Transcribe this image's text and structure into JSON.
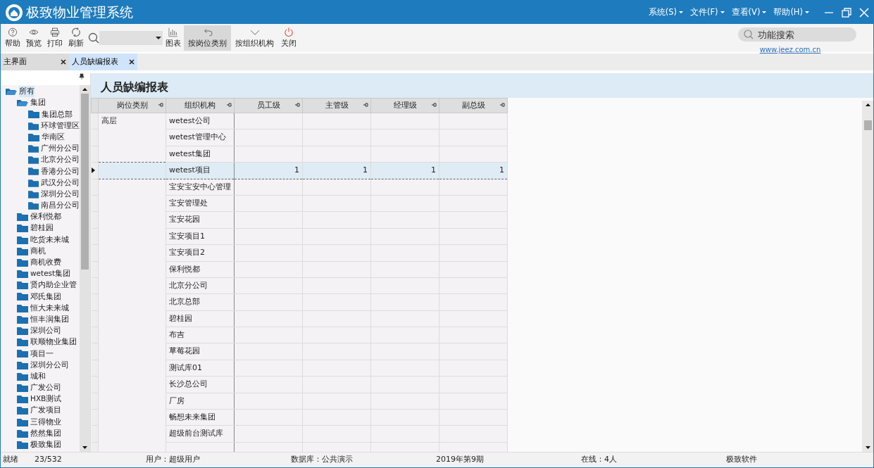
{
  "window": {
    "title": "极致物业管理系统"
  },
  "menu": [
    {
      "label": "系统(S)"
    },
    {
      "label": "文件(F)"
    },
    {
      "label": "查看(V)"
    },
    {
      "label": "帮助(H)"
    }
  ],
  "toolbar": [
    {
      "kind": "help",
      "label": "帮助",
      "selected": false
    },
    {
      "kind": "preview",
      "label": "预览",
      "selected": false
    },
    {
      "kind": "print",
      "label": "打印",
      "selected": false
    },
    {
      "kind": "refresh",
      "label": "刷新",
      "selected": false
    },
    {
      "kind": "chart",
      "label": "图表",
      "selected": false
    },
    {
      "kind": "back",
      "label": "按岗位类别",
      "selected": true
    },
    {
      "kind": "down",
      "label": "按组织机构",
      "selected": false
    },
    {
      "kind": "power",
      "label": "关闭",
      "selected": false
    }
  ],
  "function_search": {
    "placeholder": "功能搜索"
  },
  "website": "www.jeez.com.cn",
  "tabs": [
    {
      "label": "主界面",
      "selected": false
    },
    {
      "label": "人员缺编报表",
      "selected": true
    }
  ],
  "tree": [
    {
      "label": "所有",
      "selected": true,
      "expanded": true,
      "children": [
        {
          "label": "集团",
          "selected": false,
          "expanded": true,
          "children": [
            {
              "label": "集团总部",
              "selected": false,
              "expanded": false
            },
            {
              "label": "环球管理区",
              "selected": false,
              "expanded": false
            },
            {
              "label": "华南区",
              "selected": false,
              "expanded": false
            },
            {
              "label": "广州分公司",
              "selected": false,
              "expanded": false
            },
            {
              "label": "北京分公司",
              "selected": false,
              "expanded": false
            },
            {
              "label": "香港分公司",
              "selected": false,
              "expanded": false
            },
            {
              "label": "武汉分公司",
              "selected": false,
              "expanded": false
            },
            {
              "label": "深圳分公司",
              "selected": false,
              "expanded": false
            },
            {
              "label": "南昌分公司",
              "selected": false,
              "expanded": false
            }
          ]
        },
        {
          "label": "保利悦都",
          "selected": false,
          "expanded": false
        },
        {
          "label": "碧桂园",
          "selected": false,
          "expanded": false
        },
        {
          "label": "吃货未来城",
          "selected": false,
          "expanded": false
        },
        {
          "label": "商机",
          "selected": false,
          "expanded": false
        },
        {
          "label": "商机收费",
          "selected": false,
          "expanded": false
        },
        {
          "label": "wetest集团",
          "selected": false,
          "expanded": false
        },
        {
          "label": "贤内助企业管",
          "selected": false,
          "expanded": false
        },
        {
          "label": "邓氏集团",
          "selected": false,
          "expanded": false
        },
        {
          "label": "恒大未来城",
          "selected": false,
          "expanded": false
        },
        {
          "label": "恒丰润集团",
          "selected": false,
          "expanded": false
        },
        {
          "label": "深圳公司",
          "selected": false,
          "expanded": false
        },
        {
          "label": "联顺物业集团",
          "selected": false,
          "expanded": false
        },
        {
          "label": "项目一",
          "selected": false,
          "expanded": false
        },
        {
          "label": "深圳分公司",
          "selected": false,
          "expanded": false
        },
        {
          "label": "城和",
          "selected": false,
          "expanded": false
        },
        {
          "label": "广发公司",
          "selected": false,
          "expanded": false
        },
        {
          "label": "HXB测试",
          "selected": false,
          "expanded": false
        },
        {
          "label": "广发项目",
          "selected": false,
          "expanded": false
        },
        {
          "label": "三得物业",
          "selected": false,
          "expanded": false
        },
        {
          "label": "然然集团",
          "selected": false,
          "expanded": false
        },
        {
          "label": "极致集团",
          "selected": false,
          "expanded": false
        }
      ]
    }
  ],
  "report": {
    "title": "人员缺编报表",
    "columns": [
      "岗位类别",
      "组织机构",
      "员工级",
      "主管级",
      "经理级",
      "副总级"
    ],
    "rows": [
      {
        "category": "高层",
        "org": "wetest公司",
        "selected": false
      },
      {
        "org": "wetest管理中心",
        "selected": false
      },
      {
        "org": "wetest集团",
        "selected": false
      },
      {
        "org": "wetest项目",
        "values": [
          "1",
          "1",
          "1",
          "1"
        ],
        "selected": true
      },
      {
        "org": "宝安宝安中心管理",
        "selected": false
      },
      {
        "org": "宝安管理处",
        "selected": false
      },
      {
        "org": "宝安花园",
        "selected": false
      },
      {
        "org": "宝安项目1",
        "selected": false
      },
      {
        "org": "宝安项目2",
        "selected": false
      },
      {
        "org": "保利悦都",
        "selected": false
      },
      {
        "org": "北京分公司",
        "selected": false
      },
      {
        "org": "北京总部",
        "selected": false
      },
      {
        "org": "碧桂园",
        "selected": false
      },
      {
        "org": "布吉",
        "selected": false
      },
      {
        "org": "草莓花园",
        "selected": false
      },
      {
        "org": "测试库01",
        "selected": false
      },
      {
        "org": "长沙总公司",
        "selected": false
      },
      {
        "org": "厂房",
        "selected": false
      },
      {
        "org": "畅想未来集团",
        "selected": false
      },
      {
        "org": "超级前台测试库",
        "selected": false
      }
    ]
  },
  "status_bar": [
    "就绪",
    "23/532",
    "用户：超级用户",
    "数据库：公共演示",
    "2019年第9期",
    "在线：4人",
    "极致软件"
  ]
}
